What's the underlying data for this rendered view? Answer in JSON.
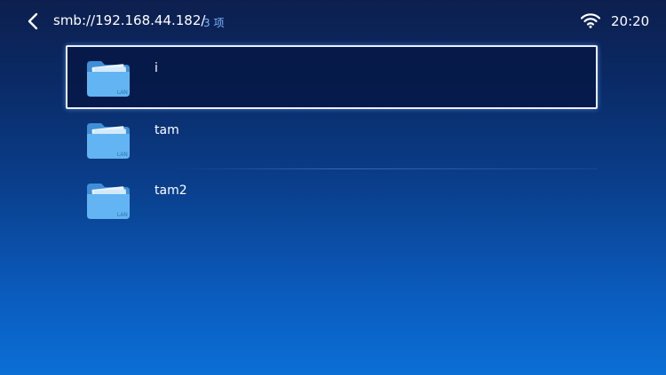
{
  "header": {
    "path": "smb://192.168.44.182/",
    "count": "3 项",
    "time": "20:20"
  },
  "items": [
    {
      "name": "i",
      "selected": true,
      "badge": "LAN"
    },
    {
      "name": "tam",
      "selected": false,
      "badge": "LAN"
    },
    {
      "name": "tam2",
      "selected": false,
      "badge": "LAN"
    }
  ],
  "icons": {
    "back": "back-arrow-icon",
    "wifi": "wifi-icon",
    "folder": "lan-folder-icon"
  },
  "colors": {
    "accent": "#7fb4ff",
    "folder": "#5fb0f0"
  }
}
